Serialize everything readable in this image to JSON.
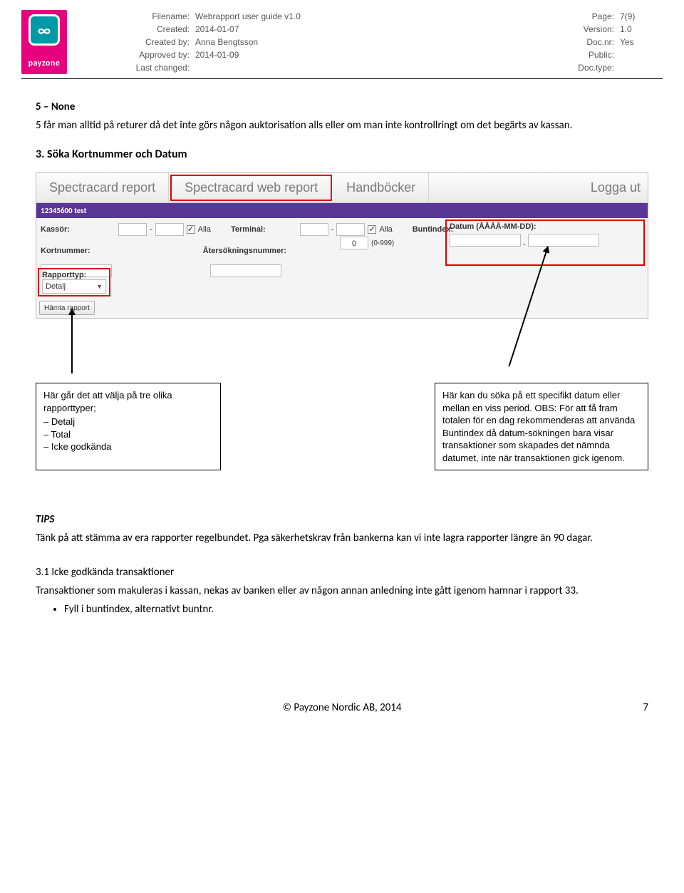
{
  "logo": {
    "brand": "payzone"
  },
  "meta": {
    "labels_left": [
      "Filename:",
      "Created:",
      "Created by:",
      "Approved by:",
      "Last changed:"
    ],
    "vals_left": [
      "Webrapport user guide v1.0",
      "2014-01-07",
      "Anna Bengtsson",
      "",
      "2014-01-09"
    ],
    "labels_right": [
      "Page:",
      "Version:",
      "Doc.nr:",
      "Public:",
      "Doc.type:"
    ],
    "vals_right": [
      "7(9)",
      "1.0",
      "",
      "Yes",
      ""
    ]
  },
  "section5": {
    "title": "5 – None",
    "body": "5 får man alltid på returer då det inte görs någon auktorisation alls eller om man inte kontrollringt om det begärts av kassan."
  },
  "section3": {
    "title": "3. Söka Kortnummer och Datum"
  },
  "shot": {
    "tabs": [
      "Spectracard report",
      "Spectracard web report",
      "Handböcker",
      "Logga ut"
    ],
    "purple": "12345600 test",
    "labels": {
      "kassor": "Kassör:",
      "alla": "Alla",
      "terminal": "Terminal:",
      "buntindex": "Buntindex:",
      "buntrange": "(0-999)",
      "datum": "Datum (ÅÅÅÅ-MM-DD):",
      "kortnr": "Kortnummer:",
      "atersok": "Återsökningsnummer:",
      "rapporttyp": "Rapporttyp:",
      "detalj": "Detalj",
      "hamta": "Hämta rapport"
    },
    "buntindex_val": "0"
  },
  "callout_left": {
    "lead": "Här går det att välja på tre olika rapporttyper;",
    "items": [
      "Detalj",
      "Total",
      "Icke godkända"
    ]
  },
  "callout_right": {
    "text": "Här kan du söka på ett specifikt datum eller mellan en viss period. OBS: För att få fram totalen för en dag rekommenderas att använda Buntindex då datum-sökningen bara visar transaktioner som skapades det nämnda datumet, inte när transaktionen gick igenom."
  },
  "tips": {
    "hd": "TIPS",
    "body": "Tänk på att stämma av era rapporter regelbundet. Pga säkerhetskrav från bankerna kan vi inte lagra rapporter längre än 90 dagar."
  },
  "sec31": {
    "hd": "3.1 Icke godkända transaktioner",
    "body": "Transaktioner som makuleras i kassan, nekas av banken eller av någon annan anledning inte gått igenom hamnar i rapport 33.",
    "bullet": "Fyll i buntindex, alternativt buntnr."
  },
  "footer": {
    "copyright": "© Payzone Nordic AB, 2014",
    "page": "7"
  }
}
